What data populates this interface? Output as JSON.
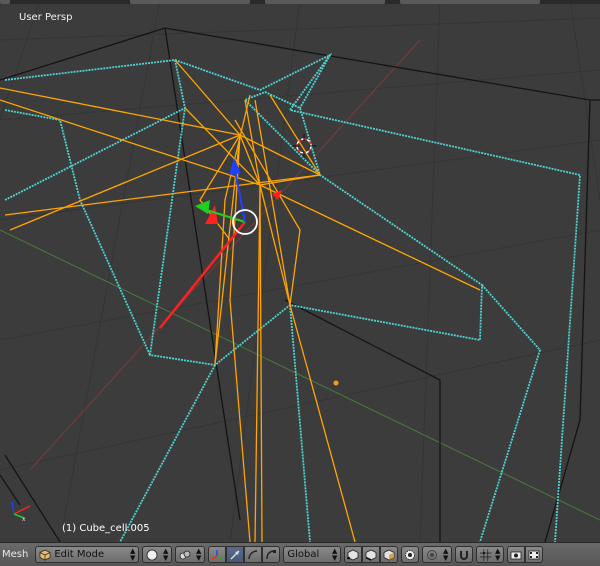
{
  "viewport": {
    "view_label": "User Persp",
    "object_label": "(1) Cube_cell.005"
  },
  "header": {
    "editor_type": "Mesh",
    "mode": "Edit Mode",
    "transform_orientation": "Global"
  },
  "colors": {
    "background": "#3c3c3c",
    "wire_selected": "#ffa500",
    "wire_seam": "#4fd2d2",
    "edge": "#141414",
    "x_axis": "#ff2020",
    "y_axis": "#20d020",
    "z_axis": "#2040ff"
  },
  "icons": {
    "mode_icon": "mesh-cube-icon",
    "shading_icon": "solid-sphere-icon",
    "pivot_icon": "pivot-point-icon",
    "manipulator_icon": "manipulator-icon",
    "translate_icon": "translate-arrow-icon",
    "rotate_icon": "rotate-icon",
    "scale_icon": "scale-icon",
    "vertex_select_icon": "vertex-select-icon",
    "edge_select_icon": "edge-select-icon",
    "face_select_icon": "face-select-icon",
    "occlude_icon": "occlude-geometry-icon",
    "proportional_icon": "proportional-edit-icon",
    "snap_icon": "magnet-snap-icon",
    "snap_element_icon": "snap-element-icon",
    "render_icon": "render-icon",
    "render_anim_icon": "render-anim-icon"
  }
}
